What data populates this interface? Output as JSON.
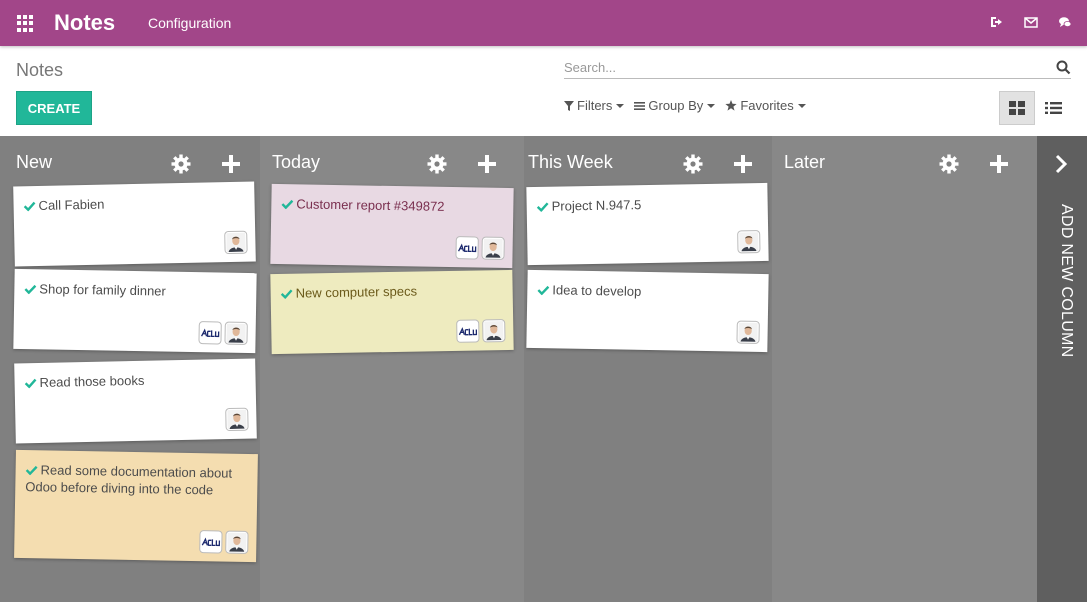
{
  "app": {
    "brand": "Notes",
    "menu": [
      "Configuration"
    ],
    "colors": {
      "topbar": "#a24689",
      "create_button": "#21b799",
      "kanban_bg": "#888888",
      "add_column_bg": "#5f5f5f",
      "check": "#21b799"
    }
  },
  "control_panel": {
    "breadcrumb": "Notes",
    "create_label": "CREATE",
    "search_placeholder": "Search...",
    "filters_label": "Filters",
    "groupby_label": "Group By",
    "favorites_label": "Favorites"
  },
  "columns": [
    {
      "title": "New",
      "cards": [
        {
          "title": "Call Fabien",
          "color": "#ffffff",
          "avatars": [
            "person"
          ]
        },
        {
          "title": "Shop for family dinner",
          "color": "#ffffff",
          "avatars": [
            "logo",
            "person"
          ]
        },
        {
          "title": "Read those books",
          "color": "#ffffff",
          "avatars": [
            "person"
          ]
        },
        {
          "title": "Read some documentation about Odoo before diving into the code",
          "color": "#f4ddb0",
          "avatars": [
            "logo",
            "person"
          ]
        }
      ]
    },
    {
      "title": "Today",
      "cards": [
        {
          "title": "Customer report #349872",
          "color": "#e8d9e3",
          "avatars": [
            "logo",
            "person"
          ]
        },
        {
          "title": "New computer specs",
          "color": "#eeebbf",
          "avatars": [
            "logo",
            "person"
          ]
        }
      ]
    },
    {
      "title": "This Week",
      "cards": [
        {
          "title": "Project N.947.5",
          "color": "#ffffff",
          "avatars": [
            "person"
          ]
        },
        {
          "title": "Idea to develop",
          "color": "#ffffff",
          "avatars": [
            "person"
          ]
        }
      ]
    },
    {
      "title": "Later",
      "cards": []
    }
  ],
  "add_column_label": "ADD NEW COLUMN"
}
